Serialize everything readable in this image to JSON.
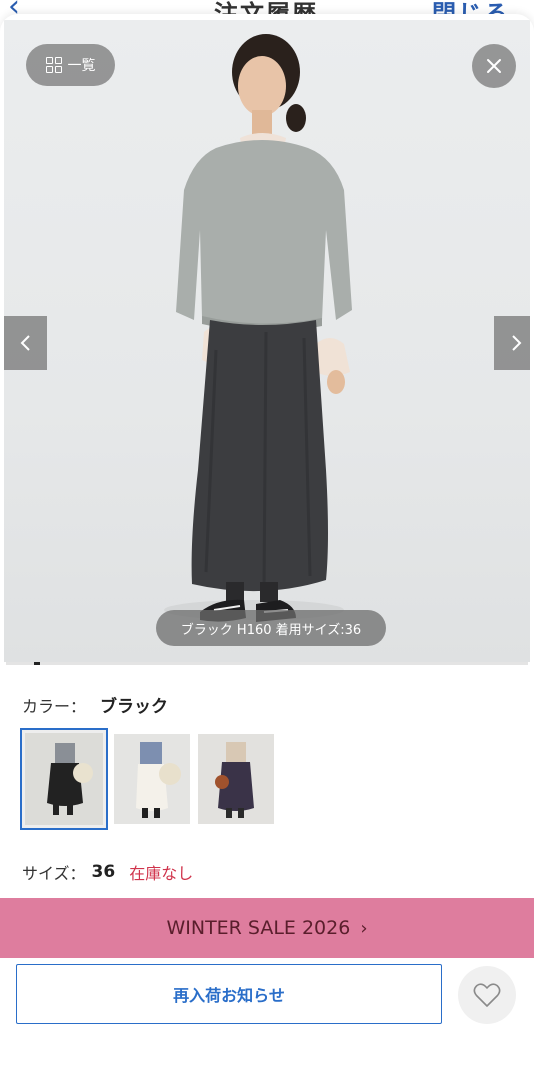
{
  "background_header": {
    "title": "注文履歴",
    "close_label": "閉じる",
    "back_icon": "chevron-left-icon"
  },
  "gallery": {
    "list_button_label": "一覧",
    "list_icon": "grid-icon",
    "close_icon": "close-icon",
    "prev_icon": "chevron-left-icon",
    "next_icon": "chevron-right-icon",
    "caption": "ブラック H160 着用サイズ:36"
  },
  "color": {
    "label": "カラー：",
    "selected": "ブラック",
    "swatches": [
      {
        "name": "ブラック",
        "selected": true
      },
      {
        "name": "ホワイト",
        "selected": false
      },
      {
        "name": "ネイビー",
        "selected": false
      }
    ]
  },
  "size": {
    "label": "サイズ：",
    "value": "36",
    "stock_status": "在庫なし"
  },
  "sale_banner": {
    "label": "WINTER SALE 2026",
    "chevron": "›"
  },
  "actions": {
    "restock_label": "再入荷お知らせ",
    "favorite_icon": "heart-icon"
  },
  "colors": {
    "accent": "#2a6ec9",
    "sale_banner": "#de7d9e",
    "stock_out": "#d0344c"
  }
}
